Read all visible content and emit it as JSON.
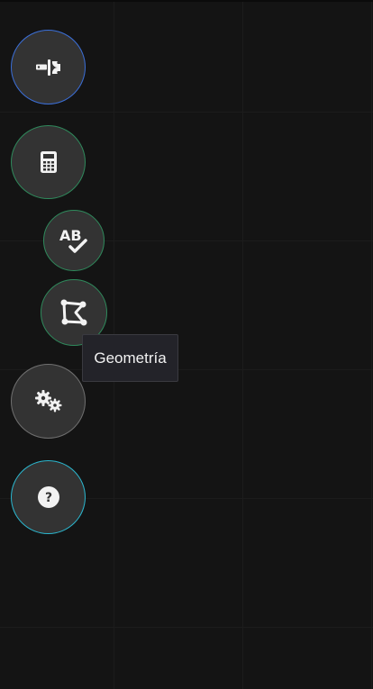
{
  "colors": {
    "background": "#141414",
    "button_fill": "#333333",
    "icon_fill": "#f2f2f2",
    "tools_border": "#3b6fd8",
    "calculator_border": "#2f8a5c",
    "spellcheck_border": "#2f8a5c",
    "geometry_border": "#2f8a5c",
    "settings_border": "#707070",
    "help_border": "#2bb7cf",
    "tooltip_bg": "#232329"
  },
  "buttons": [
    {
      "id": "tools",
      "icon": "tools-icon"
    },
    {
      "id": "calculator",
      "icon": "calculator-icon"
    },
    {
      "id": "spellcheck",
      "icon": "spellcheck-ab-icon",
      "icon_text": "AB"
    },
    {
      "id": "geometry",
      "icon": "geometry-shape-icon"
    },
    {
      "id": "settings",
      "icon": "gears-icon"
    },
    {
      "id": "help",
      "icon": "question-circle-icon",
      "icon_text": "?"
    }
  ],
  "tooltip": {
    "text": "Geometría"
  }
}
